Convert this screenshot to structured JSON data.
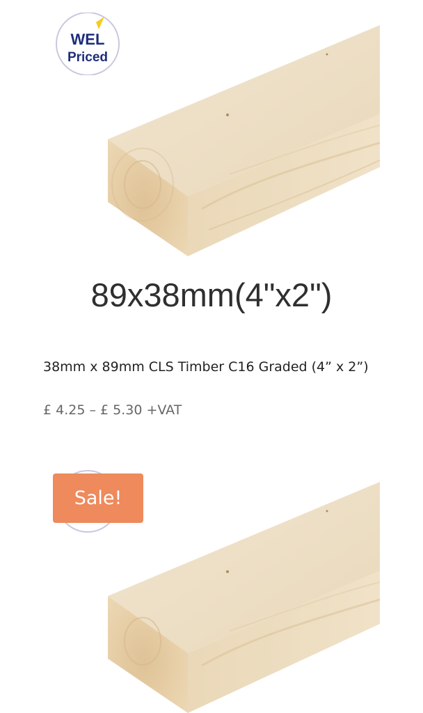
{
  "products": [
    {
      "badge_logo": {
        "line1": "WEL",
        "line2": "Priced"
      },
      "size_caption": "89x38mm(4\"x2\")",
      "title": "38mm x 89mm CLS Timber C16 Graded (4” x 2”)",
      "price": "£ 4.25 – £ 5.30 +VAT"
    },
    {
      "sale_badge": "Sale!"
    }
  ],
  "colors": {
    "sale_badge": "#ee8a5c",
    "timber_light": "#efe1c8",
    "timber_end": "#e7cda6",
    "badge_navy": "#1e2d7a",
    "badge_yellow": "#f5cc1f"
  },
  "icons": {
    "badge": "wel-priced-badge-icon"
  }
}
